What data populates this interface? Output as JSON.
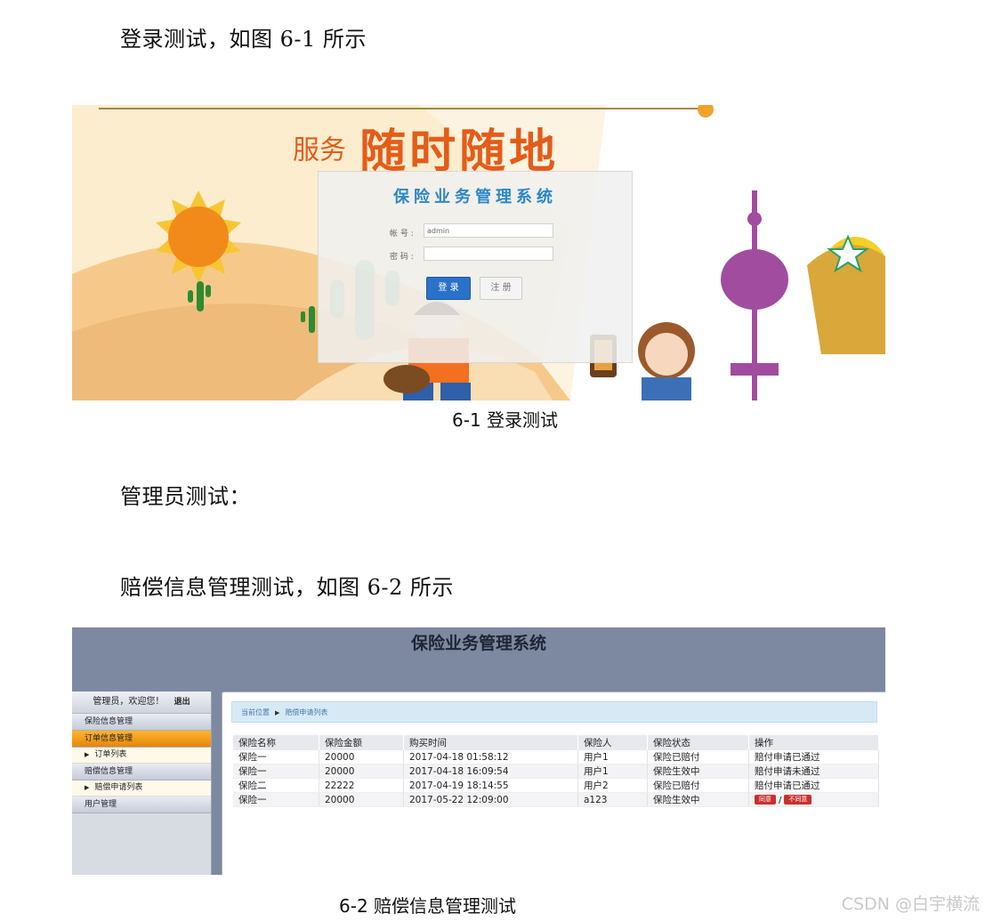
{
  "doc": {
    "para1": "登录测试，如图 6-1 所示",
    "caption1": "6-1 登录测试",
    "para2": "管理员测试：",
    "para3": "赔偿信息管理测试，如图 6-2 所示",
    "caption2": "6-2 赔偿信息管理测试",
    "watermark": "CSDN @白宇横流"
  },
  "login": {
    "banner_small": "服务",
    "banner_big": "随时随地",
    "system_title": "保险业务管理系统",
    "account_label": "帐  号 :",
    "account_value": "admin",
    "password_label": "密  码 :",
    "password_value": "",
    "login_button": "登 录",
    "register_button": "注 册"
  },
  "admin": {
    "system_title": "保险业务管理系统",
    "welcome": "管理员，欢迎您！",
    "logout": "退出",
    "menu": {
      "insurance_info": "保险信息管理",
      "order_info": "订单信息管理",
      "order_list": "订单列表",
      "claim_info": "赔偿信息管理",
      "claim_list": "赔偿申请列表",
      "user_mgmt": "用户管理"
    },
    "breadcrumb": {
      "current": "当前位置",
      "page": "赔偿申请列表"
    },
    "table": {
      "headers": [
        "保险名称",
        "保险金额",
        "购买时间",
        "保险人",
        "保险状态",
        "操作"
      ],
      "rows": [
        [
          "保险一",
          "20000",
          "2017-04-18 01:58:12",
          "用户1",
          "保险已赔付",
          "赔付申请已通过"
        ],
        [
          "保险一",
          "20000",
          "2017-04-18 16:09:54",
          "用户1",
          "保险生效中",
          "赔付申请未通过"
        ],
        [
          "保险二",
          "22222",
          "2017-04-19 18:14:55",
          "用户2",
          "保险已赔付",
          "赔付申请已通过"
        ],
        [
          "保险一",
          "20000",
          "2017-05-22 12:09:00",
          "a123",
          "保险生效中",
          ""
        ]
      ],
      "approve_label": "同意",
      "reject_label": "不同意"
    }
  }
}
